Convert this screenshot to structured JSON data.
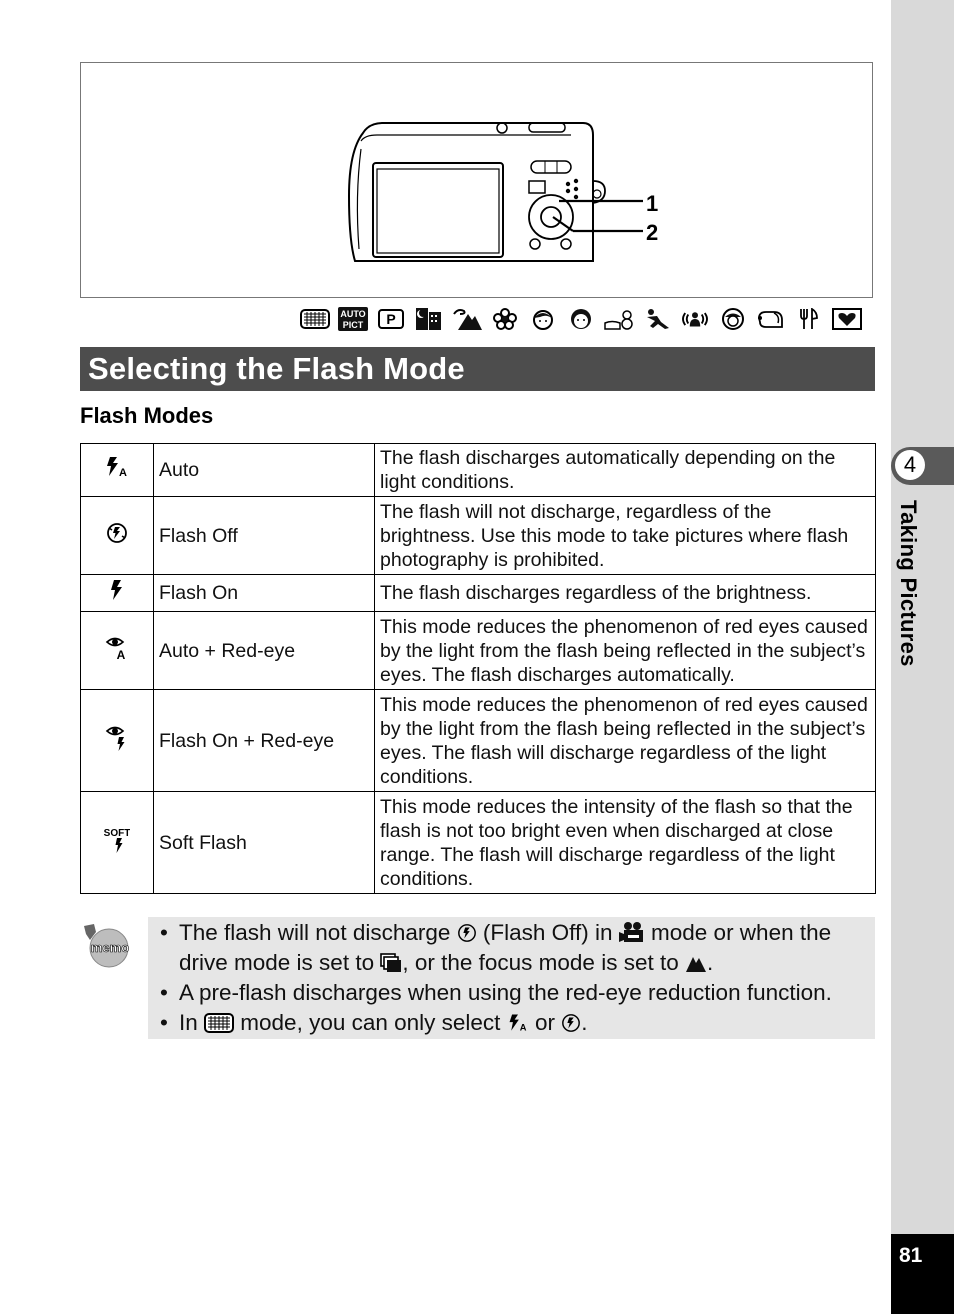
{
  "figure": {
    "callouts": [
      "1",
      "2"
    ],
    "illustration": "camera-rear-view"
  },
  "shooting_mode_icons": [
    "auto-grid-mode-icon",
    "auto-picture-icon",
    "program-icon",
    "night-scene-icon",
    "landscape-icon",
    "flower-icon",
    "portrait-icon",
    "natural-skin-tone-icon",
    "snow-icon",
    "sport-icon",
    "digital-sr-icon",
    "kids-icon",
    "pet-icon",
    "food-icon",
    "frame-composite-icon"
  ],
  "shooting_mode_labels": {
    "auto_pict": [
      "AUTO",
      "PICT"
    ],
    "program": "P"
  },
  "section": {
    "title": "Selecting the Flash Mode",
    "subtitle": "Flash Modes"
  },
  "flash_modes": [
    {
      "icon": "flash-auto-icon",
      "name": "Auto",
      "description": "The flash discharges automatically depending on the light conditions."
    },
    {
      "icon": "flash-off-icon",
      "name": "Flash Off",
      "description": "The flash will not discharge, regardless of the brightness. Use this mode to take pictures where flash photography is prohibited."
    },
    {
      "icon": "flash-on-icon",
      "name": "Flash On",
      "description": "The flash discharges regardless of the brightness."
    },
    {
      "icon": "auto-red-eye-icon",
      "name": "Auto + Red-eye",
      "description": "This mode reduces the phenomenon of red eyes caused by the light from the flash being reflected in the subject’s eyes. The flash discharges automatically."
    },
    {
      "icon": "flash-on-red-eye-icon",
      "name": "Flash On + Red-eye",
      "description": "This mode reduces the phenomenon of red eyes caused by the light from the flash being reflected in the subject’s eyes. The flash will discharge regardless of the light conditions."
    },
    {
      "icon": "soft-flash-icon",
      "name": "Soft Flash",
      "description": "This mode reduces the intensity of the flash so that the flash is not too bright even when discharged at close range. The flash will discharge regardless of the light conditions."
    }
  ],
  "soft_icon_label": "SOFT",
  "memo": {
    "label": "memo",
    "notes": [
      {
        "parts": [
          "The flash will not discharge ",
          " (Flash Off) in ",
          " mode or when the drive mode is set to ",
          ", or the focus mode is set to ",
          "."
        ]
      },
      {
        "parts": [
          "A pre-flash discharges when using the red-eye reduction function."
        ]
      },
      {
        "parts": [
          "In ",
          " mode, you can only select ",
          " or ",
          "."
        ]
      }
    ]
  },
  "side_tab": {
    "chapter_number": "4",
    "chapter_title": "Taking Pictures"
  },
  "page_number": "81"
}
